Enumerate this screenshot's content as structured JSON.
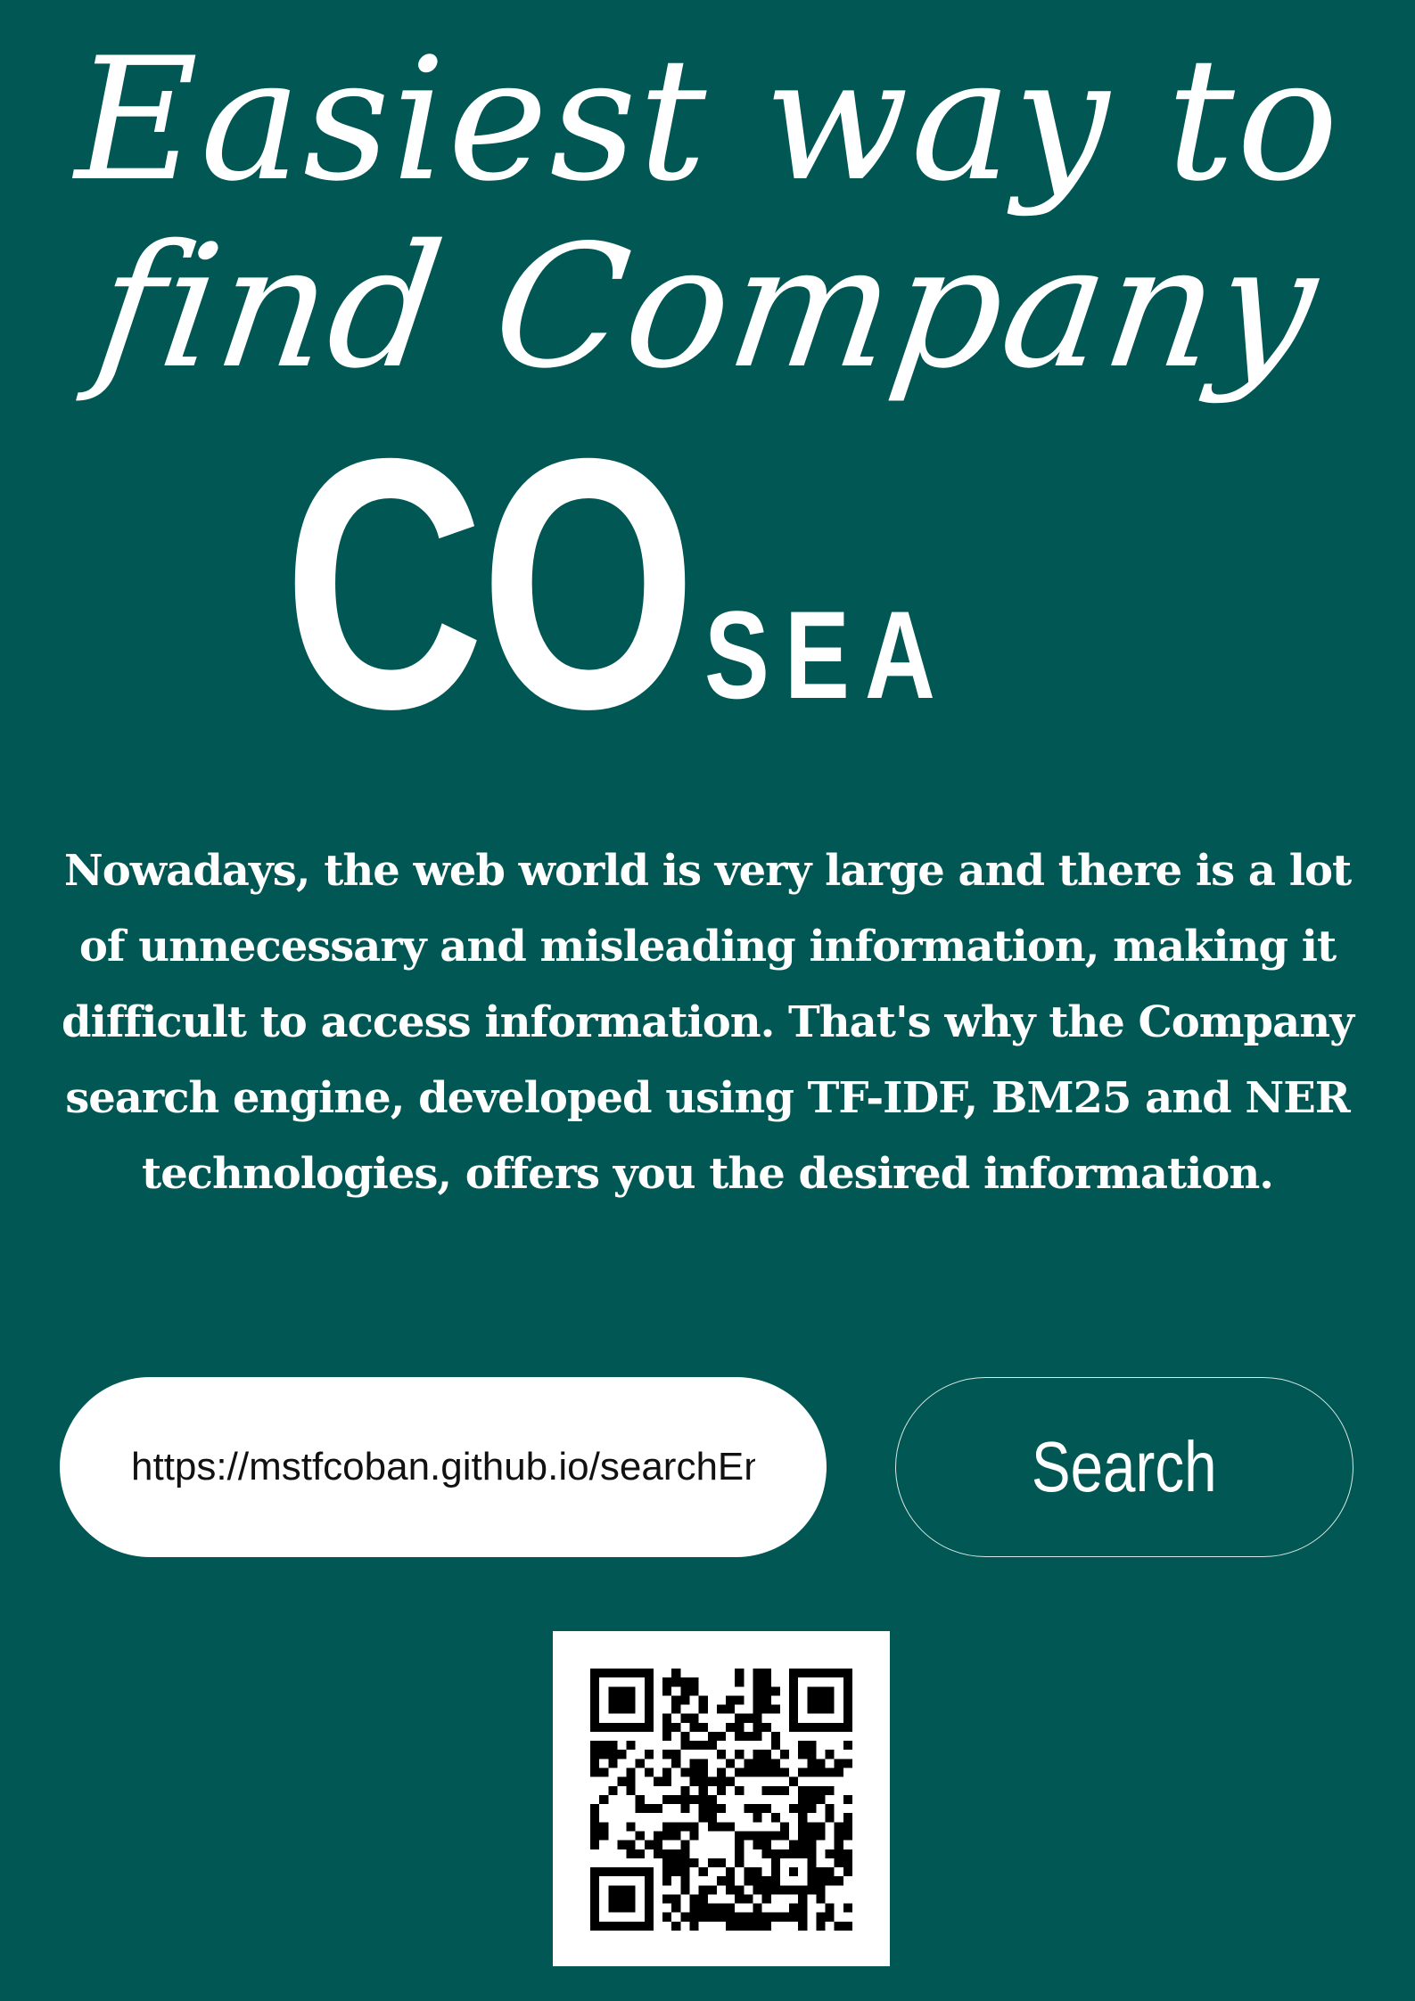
{
  "poster": {
    "tagline_line1": "Easiest way to",
    "tagline_line2": "find Company",
    "logo": {
      "big": "CO",
      "small": "SEA"
    },
    "description": "Nowadays, the web world is very large and there is a lot of unnecessary and misleading information, making it difficult to access information. That's why the Company search engine, developed using TF-IDF, BM25 and NER technologies, offers you the desired information.",
    "search": {
      "url_value": "https://mstfcoban.github.io/searchEngine |",
      "button_label": "Search"
    },
    "qr_icon": "qr-code"
  },
  "colors": {
    "background": "#005753",
    "text": "#ffffff",
    "pill": "#ffffff",
    "qr_dark": "#000000"
  }
}
